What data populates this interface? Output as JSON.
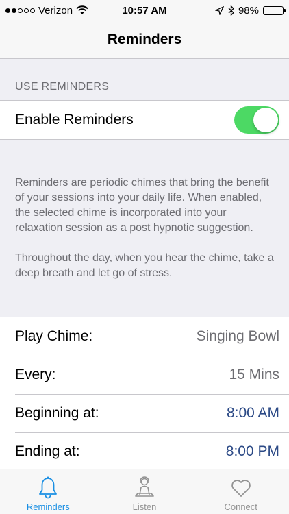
{
  "status_bar": {
    "carrier": "Verizon",
    "time": "10:57 AM",
    "battery": "98%",
    "battery_level": 0.98,
    "signal_bars_filled": 2,
    "signal_bars_total": 5
  },
  "nav": {
    "title": "Reminders"
  },
  "use_reminders": {
    "header": "USE REMINDERS",
    "enable_label": "Enable Reminders",
    "enabled": true,
    "toggle_color": "#4cd964"
  },
  "description": {
    "para1": "Reminders are periodic chimes that bring the benefit of your sessions into your daily life. When enabled, the selected chime is incorporated into your relaxation session as a post hypnotic suggestion.",
    "para2": "Throughout the day, when you hear the chime, take a deep breath and let go of stress."
  },
  "settings": {
    "play_chime_label": "Play Chime:",
    "play_chime_value": "Singing Bowl",
    "every_label": "Every:",
    "every_value": "15 Mins",
    "beginning_label": "Beginning at:",
    "beginning_value": "8:00 AM",
    "ending_label": "Ending at:",
    "ending_value": "8:00 PM"
  },
  "tabs": [
    {
      "label": "Reminders",
      "icon": "bell-icon",
      "active": true
    },
    {
      "label": "Listen",
      "icon": "meditation-person-icon",
      "active": false
    },
    {
      "label": "Connect",
      "icon": "heart-icon",
      "active": false
    }
  ],
  "colors": {
    "accent": "#1a8fe3",
    "time_value": "#2c4a86"
  }
}
